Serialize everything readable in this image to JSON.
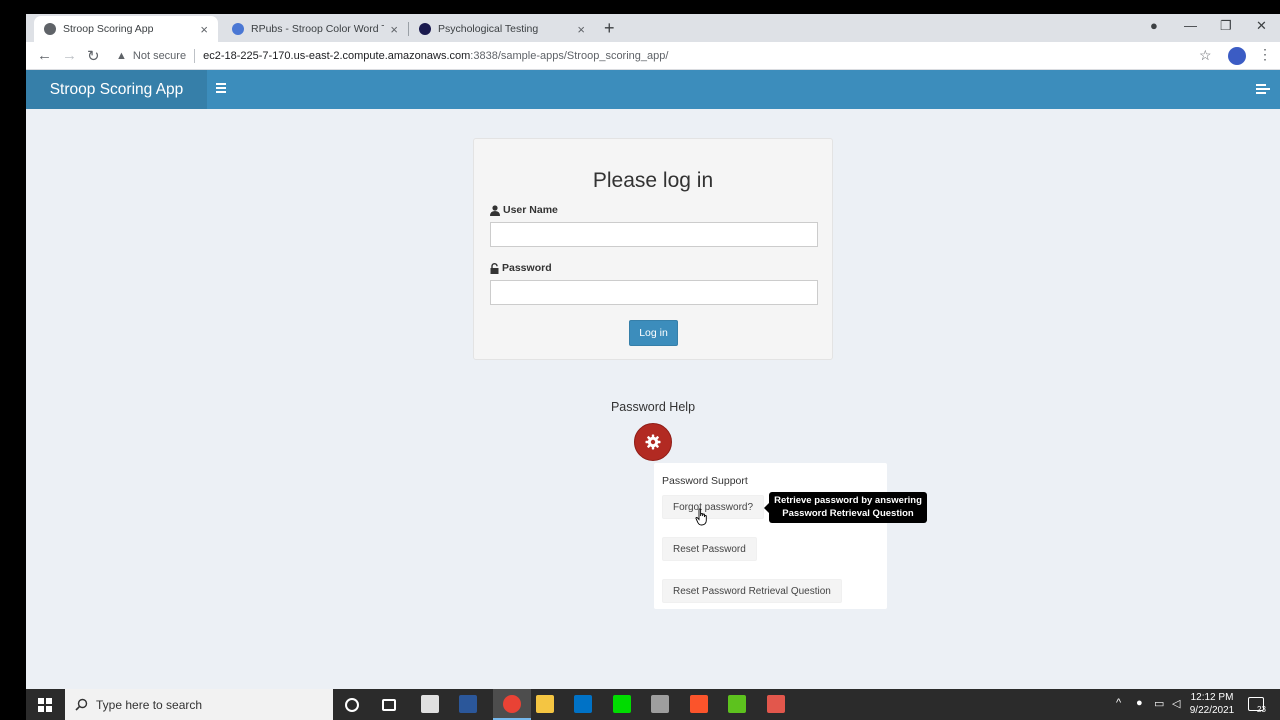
{
  "browser": {
    "tabs": [
      {
        "title": "Stroop Scoring App",
        "favicon_color": "#5f6368"
      },
      {
        "title": "RPubs - Stroop Color Word Test",
        "favicon_color": "#4a77d4"
      },
      {
        "title": "Psychological Testing",
        "favicon_color": "#1a1a4e"
      }
    ],
    "security_label": "Not secure",
    "url_host": "ec2-18-225-7-170.us-east-2.compute.amazonaws.com",
    "url_path": ":3838/sample-apps/Stroop_scoring_app/"
  },
  "app": {
    "title": "Stroop Scoring App",
    "accent": "#3c8dbc"
  },
  "login": {
    "heading": "Please log in",
    "username_label": "User Name",
    "username_value": "",
    "password_label": "Password",
    "password_value": "",
    "submit_label": "Log in"
  },
  "password_help": {
    "title": "Password Help",
    "button_color": "#b22a22",
    "menu_header": "Password Support",
    "items": [
      {
        "label": "Forgot password?"
      },
      {
        "label": "Reset Password"
      },
      {
        "label": "Reset Password Retrieval Question"
      }
    ],
    "tooltip_line1": "Retrieve password by answering",
    "tooltip_line2": "Password Retrieval Question"
  },
  "taskbar": {
    "search_placeholder": "Type here to search",
    "time": "12:12 PM",
    "date": "9/22/2021",
    "notification_count": "23"
  }
}
